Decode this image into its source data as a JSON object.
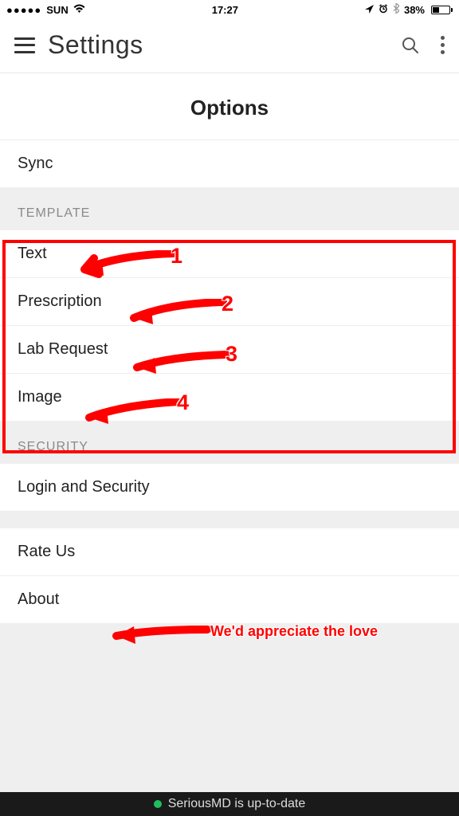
{
  "status": {
    "carrier": "SUN",
    "time": "17:27",
    "battery_pct": "38%"
  },
  "nav": {
    "title": "Settings"
  },
  "page": {
    "title": "Options"
  },
  "items": {
    "sync": "Sync",
    "template_header": "TEMPLATE",
    "text": "Text",
    "prescription": "Prescription",
    "lab_request": "Lab Request",
    "image": "Image",
    "security_header": "SECURITY",
    "login_security": "Login and Security",
    "rate_us": "Rate Us",
    "about": "About"
  },
  "footer": {
    "status": "SeriousMD is up-to-date"
  },
  "annotations": {
    "n1": "1",
    "n2": "2",
    "n3": "3",
    "n4": "4",
    "love": "We'd appreciate the love"
  }
}
